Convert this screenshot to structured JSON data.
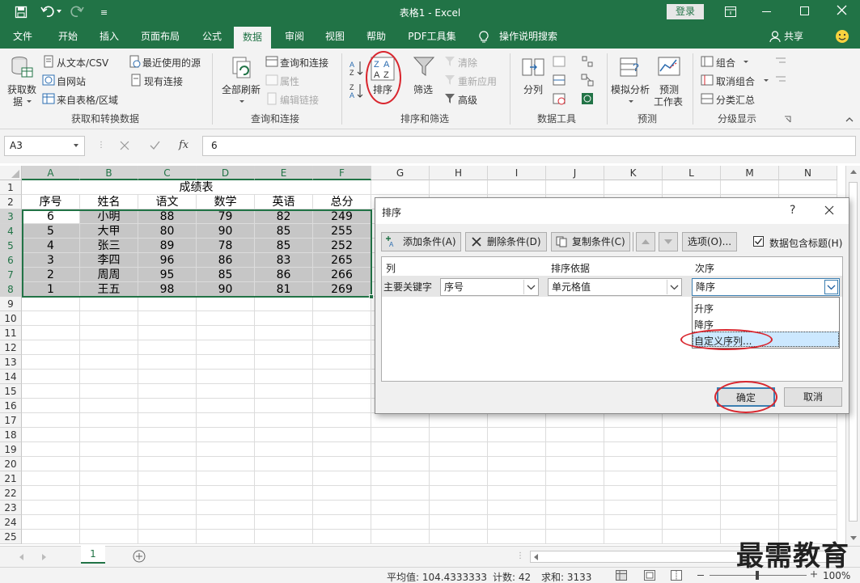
{
  "title": "表格1  -  Excel",
  "titlebar": {
    "login": "登录"
  },
  "tabs": [
    "文件",
    "开始",
    "插入",
    "页面布局",
    "公式",
    "数据",
    "审阅",
    "视图",
    "帮助",
    "PDF工具集",
    "操作说明搜索"
  ],
  "share": "共享",
  "ribbon": {
    "get_data": {
      "big": "获取数",
      "big2": "据",
      "items": [
        "从文本/CSV",
        "自网站",
        "来自表格/区域",
        "最近使用的源",
        "现有连接"
      ],
      "label": "获取和转换数据"
    },
    "queries": {
      "big": "全部刷新",
      "items": [
        "查询和连接",
        "属性",
        "编辑链接"
      ],
      "label": "查询和连接"
    },
    "sort_filter": {
      "sort": "排序",
      "filter": "筛选",
      "items": [
        "清除",
        "重新应用",
        "高级"
      ],
      "label": "排序和筛选"
    },
    "data_tools": {
      "big": "分列",
      "label": "数据工具"
    },
    "forecast": {
      "whatif": "模拟分析",
      "sheet": "预测",
      "sheet2": "工作表",
      "label": "预测"
    },
    "outline": {
      "items": [
        "组合",
        "取消组合",
        "分类汇总"
      ],
      "label": "分级显示"
    }
  },
  "formula": {
    "namebox": "A3",
    "fx": "fx",
    "value": "6"
  },
  "grid": {
    "columns": [
      "A",
      "B",
      "C",
      "D",
      "E",
      "F",
      "G",
      "H",
      "I",
      "J",
      "K",
      "L",
      "M",
      "N"
    ],
    "rows": [
      "1",
      "2",
      "3",
      "4",
      "5",
      "6",
      "7",
      "8",
      "9",
      "10",
      "11",
      "12",
      "13",
      "14",
      "15",
      "16",
      "17",
      "18",
      "19",
      "20",
      "21",
      "22",
      "23",
      "24",
      "25"
    ],
    "table_title": "成绩表",
    "headers": [
      "序号",
      "姓名",
      "语文",
      "数学",
      "英语",
      "总分"
    ],
    "data": [
      [
        "6",
        "小明",
        "88",
        "79",
        "82",
        "249"
      ],
      [
        "5",
        "大甲",
        "80",
        "90",
        "85",
        "255"
      ],
      [
        "4",
        "张三",
        "89",
        "78",
        "85",
        "252"
      ],
      [
        "3",
        "李四",
        "96",
        "86",
        "83",
        "265"
      ],
      [
        "2",
        "周周",
        "95",
        "85",
        "86",
        "266"
      ],
      [
        "1",
        "王五",
        "98",
        "90",
        "81",
        "269"
      ]
    ]
  },
  "sheet_tab": "1",
  "status": {
    "avg": "平均值: 104.4333333",
    "count": "计数: 42",
    "sum": "求和: 3133",
    "zoom": "100%"
  },
  "dialog": {
    "title": "排序",
    "help": "?",
    "add": "添加条件(A)",
    "delete": "删除条件(D)",
    "copy": "复制条件(C)",
    "options": "选项(O)...",
    "has_header": "数据包含标题(H)",
    "col_header": "列",
    "sort_on_header": "排序依据",
    "order_header": "次序",
    "row_label": "主要关键字",
    "col_value": "序号",
    "sort_on_value": "单元格值",
    "order_value": "降序",
    "order_options": [
      "升序",
      "降序",
      "自定义序列..."
    ],
    "ok": "确定",
    "cancel": "取消"
  },
  "watermark": "最需教育",
  "colors": {
    "accent": "#217346",
    "highlight": "#d9262e",
    "selection": "#cce8ff"
  }
}
